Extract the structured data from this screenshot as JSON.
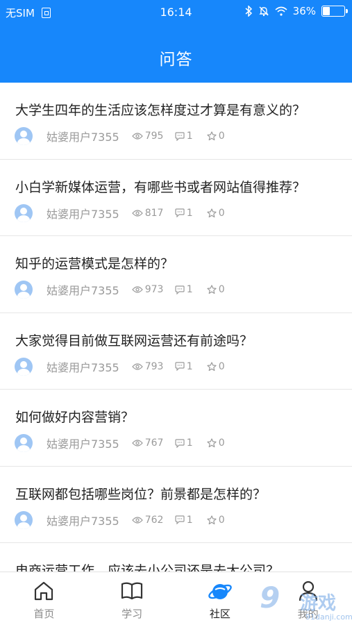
{
  "status_bar": {
    "carrier": "无SIM",
    "time": "16:14",
    "battery_percent": "36%",
    "battery_level": 0.36,
    "icons": [
      "sim-icon",
      "bluetooth-icon",
      "mute-bell-icon",
      "wifi-icon",
      "battery-icon"
    ]
  },
  "header": {
    "title": "问答"
  },
  "questions": [
    {
      "title": "大学生四年的生活应该怎样度过才算是有意义的？",
      "author": "姑婆用户7355",
      "views": "795",
      "comments": "1",
      "favorites": "0"
    },
    {
      "title": "小白学新媒体运营，有哪些书或者网站值得推荐？",
      "author": "姑婆用户7355",
      "views": "817",
      "comments": "1",
      "favorites": "0"
    },
    {
      "title": "知乎的运营模式是怎样的？",
      "author": "姑婆用户7355",
      "views": "973",
      "comments": "1",
      "favorites": "0"
    },
    {
      "title": "大家觉得目前做互联网运营还有前途吗？",
      "author": "姑婆用户7355",
      "views": "793",
      "comments": "1",
      "favorites": "0"
    },
    {
      "title": "如何做好内容营销？",
      "author": "姑婆用户7355",
      "views": "767",
      "comments": "1",
      "favorites": "0"
    },
    {
      "title": "互联网都包括哪些岗位？前景都是怎样的？",
      "author": "姑婆用户7355",
      "views": "762",
      "comments": "1",
      "favorites": "0"
    },
    {
      "title": "电商运营工作，应该去小公司还是去大公司？",
      "author": "",
      "views": "",
      "comments": "",
      "favorites": ""
    }
  ],
  "tabbar": {
    "tabs": [
      {
        "label": "首页",
        "icon": "home-icon"
      },
      {
        "label": "学习",
        "icon": "book-icon"
      },
      {
        "label": "社区",
        "icon": "planet-icon",
        "active": true
      },
      {
        "label": "我的",
        "icon": "user-icon"
      }
    ]
  },
  "watermark": {
    "big": "9",
    "cn": "游戏",
    "url": "91danji.com"
  },
  "colors": {
    "primary": "#1787fb",
    "text": "#222222",
    "meta": "#9a9a9a",
    "avatar": "#9fc6f4"
  }
}
